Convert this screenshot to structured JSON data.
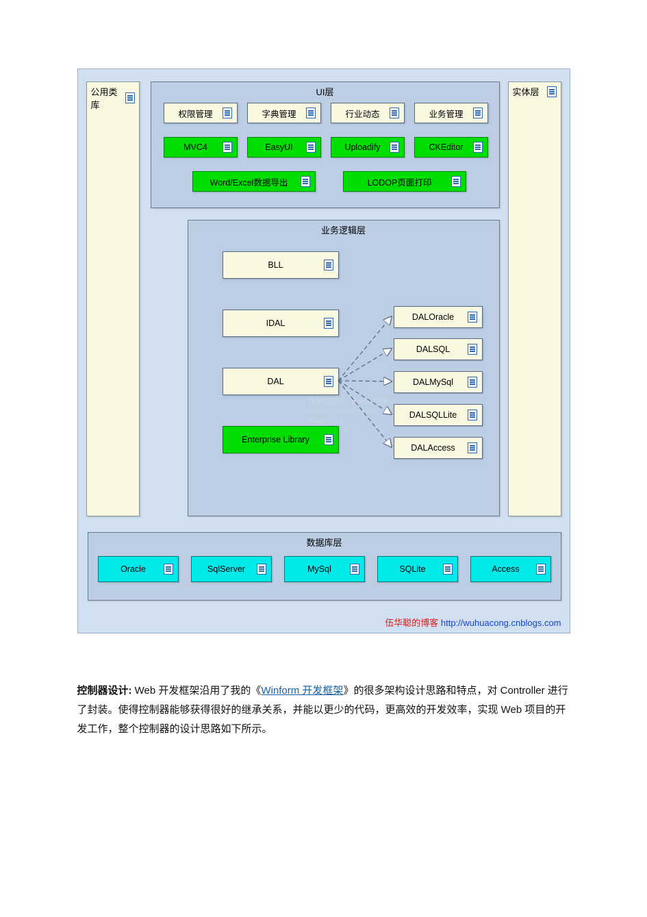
{
  "columns": {
    "left": {
      "label": "公用类库"
    },
    "right": {
      "label": "实体层"
    }
  },
  "ui_layer": {
    "title": "UI层",
    "row1": [
      "权限管理",
      "字典管理",
      "行业动态",
      "业务管理"
    ],
    "row2": [
      "MVC4",
      "EasyUI",
      "Uploadify",
      "CKEditor"
    ],
    "row3": [
      "Word/Excel数据导出",
      "LODOP页面打印"
    ]
  },
  "logic_layer": {
    "title": "业务逻辑层",
    "left_stack": [
      "BLL",
      "IDAL",
      "DAL",
      "Enterprise Library"
    ],
    "dal_targets": [
      "DALOracle",
      "DALSQL",
      "DALMySql",
      "DALSQLLite",
      "DALAccess"
    ],
    "watermark": {
      "line1": "业务逻辑层 : public 边界",
      "line2": "Author: Administrator",
      "line3": "Phase: 1.0",
      "line4": "Version: 1.0"
    }
  },
  "db_layer": {
    "title": "数据库层",
    "items": [
      "Oracle",
      "SqlServer",
      "MySql",
      "SQLite",
      "Access"
    ]
  },
  "credit": {
    "zh": "伍华聪的博客",
    "url": "http://wuhuacong.cnblogs.com"
  },
  "paragraph": {
    "lead": "控制器设计:",
    "t1": " Web 开发框架沿用了我的《",
    "link": "Winform 开发框架",
    "t2": "》的很多架构设计思路和特点，对 Controller 进行了封装。使得控制器能够获得很好的继承关系，并能以更少的代码，更高效的开发效率，实现 Web 项目的开发工作，整个控制器的设计思路如下所示。"
  }
}
